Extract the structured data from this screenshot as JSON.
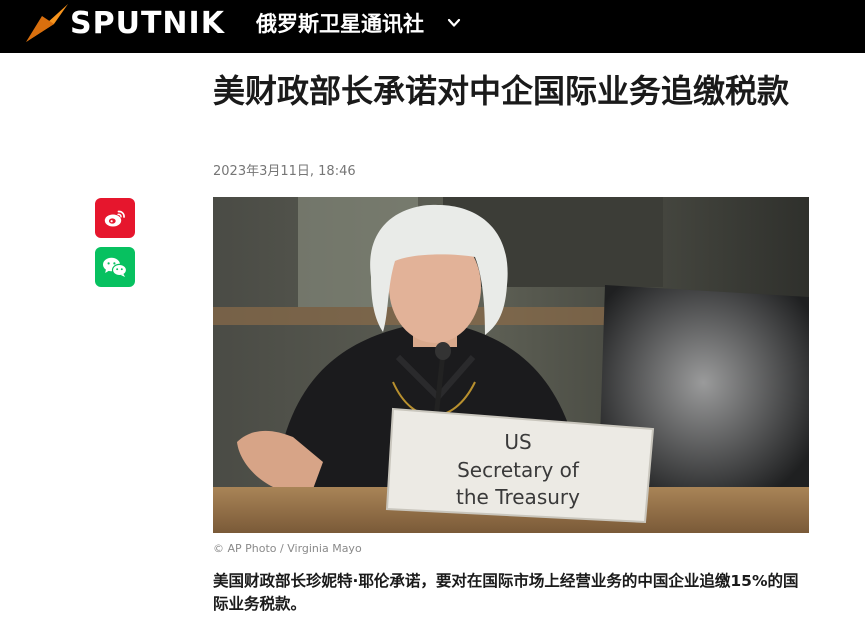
{
  "header": {
    "brand": "SPUTNIK",
    "site_name": "俄罗斯卫星通讯社",
    "logo_icon": "sputnik-logo-icon",
    "menu_icon": "chevron-down-icon",
    "brand_color": "#f7941d"
  },
  "share": {
    "weibo_icon": "weibo-icon",
    "wechat_icon": "wechat-icon",
    "weibo_color": "#e6162d",
    "wechat_color": "#07c160"
  },
  "article": {
    "title": "美财政部长承诺对中企国际业务追缴税款",
    "date": "2023年3月11日, 18:46",
    "photo": {
      "sign_lines": [
        "US",
        "Secretary of",
        "the Treasury"
      ],
      "credit": "© AP Photo / Virginia Mayo"
    },
    "lead": "美国财政部长珍妮特·耶伦承诺，要对在国际市场上经营业务的中国企业追缴15%的国际业务税款。"
  }
}
